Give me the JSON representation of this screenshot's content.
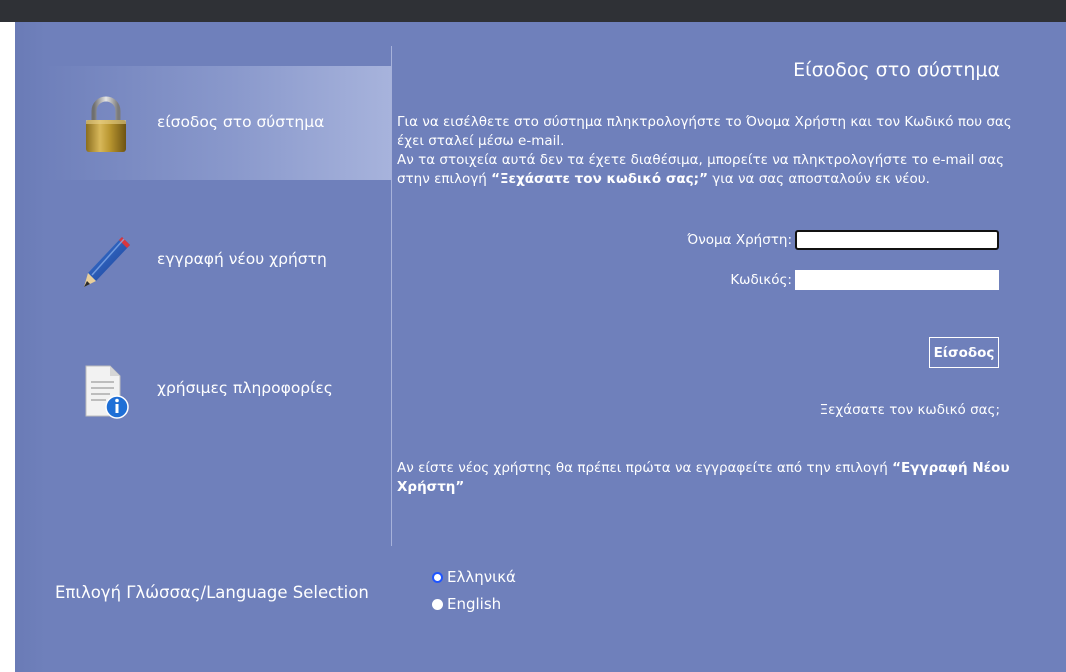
{
  "nav": {
    "login": "είσοδος στο σύστημα",
    "register": "εγγραφή νέου χρήστη",
    "info": "χρήσιμες πληροφορίες"
  },
  "main": {
    "title": "Είσοδος στο σύστημα",
    "intro_line1": "Για να εισέλθετε στο σύστημα πληκτρολογήστε το Όνομα Χρήστη και τον Κωδικό που σας έχει σταλεί μέσω e-mail.",
    "intro_line2_part1": "Αν τα στοιχεία αυτά δεν τα έχετε διαθέσιμα, μπορείτε να πληκτρολογήστε το e-mail σας στην επιλογή ",
    "intro_line2_bold": "“Ξεχάσατε τον κωδικό σας;”",
    "intro_line2_part2": " για να σας αποσταλούν εκ νέου.",
    "username_label": "Όνομα Χρήστη:",
    "username_value": "",
    "password_label": "Κωδικός:",
    "password_value": "",
    "login_button": "Είσοδος",
    "forgot_link": "Ξεχάσατε τον κωδικό σας;",
    "newuser_part1": "Αν είστε νέος χρήστης θα πρέπει πρώτα να εγγραφείτε από την επιλογή ",
    "newuser_bold": "“Εγγραφή Νέου Χρήστη”"
  },
  "language": {
    "label": "Επιλογή Γλώσσας/Language Selection",
    "options": [
      "Ελληνικά",
      "English"
    ],
    "selected": "Ελληνικά"
  },
  "icons": {
    "login": "padlock-icon",
    "register": "pencil-icon",
    "info": "document-info-icon"
  },
  "colors": {
    "panel": "#6f80bb",
    "topbar": "#2f3136",
    "radio_selected": "#1f55ff"
  }
}
